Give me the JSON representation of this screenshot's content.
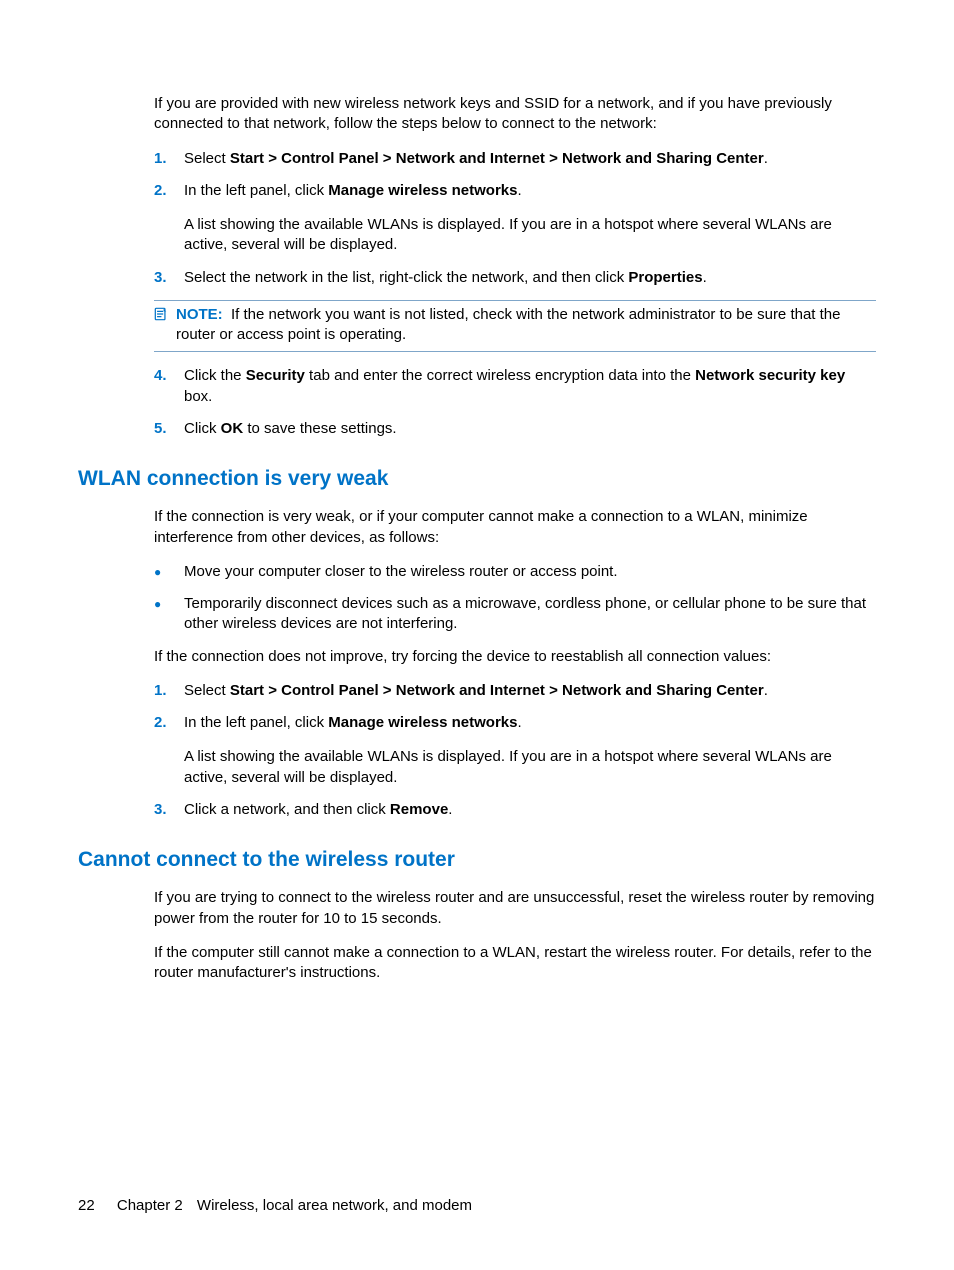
{
  "intro_para": "If you are provided with new wireless network keys and SSID for a network, and if you have previously connected to that network, follow the steps below to connect to the network:",
  "section1": {
    "steps": [
      {
        "num": "1.",
        "pre": "Select ",
        "bold": "Start > Control Panel > Network and Internet > Network and Sharing Center",
        "post": "."
      },
      {
        "num": "2.",
        "pre": "In the left panel, click ",
        "bold": "Manage wireless networks",
        "post": ".",
        "extra": "A list showing the available WLANs is displayed. If you are in a hotspot where several WLANs are active, several will be displayed."
      },
      {
        "num": "3.",
        "pre": "Select the network in the list, right-click the network, and then click ",
        "bold": "Properties",
        "post": "."
      }
    ],
    "note_label": "NOTE:",
    "note_text": "If the network you want is not listed, check with the network administrator to be sure that the router or access point is operating.",
    "steps_after": [
      {
        "num": "4.",
        "pre": "Click the ",
        "bold1": "Security",
        "mid": " tab and enter the correct wireless encryption data into the ",
        "bold2": "Network security key",
        "post": " box."
      },
      {
        "num": "5.",
        "pre": "Click ",
        "bold": "OK",
        "post": " to save these settings."
      }
    ]
  },
  "section2": {
    "heading": "WLAN connection is very weak",
    "intro": "If the connection is very weak, or if your computer cannot make a connection to a WLAN, minimize interference from other devices, as follows:",
    "bullets": [
      "Move your computer closer to the wireless router or access point.",
      "Temporarily disconnect devices such as a microwave, cordless phone, or cellular phone to be sure that other wireless devices are not interfering."
    ],
    "after_bullets": "If the connection does not improve, try forcing the device to reestablish all connection values:",
    "steps": [
      {
        "num": "1.",
        "pre": "Select ",
        "bold": "Start > Control Panel > Network and Internet > Network and Sharing Center",
        "post": "."
      },
      {
        "num": "2.",
        "pre": "In the left panel, click ",
        "bold": "Manage wireless networks",
        "post": ".",
        "extra": "A list showing the available WLANs is displayed. If you are in a hotspot where several WLANs are active, several will be displayed."
      },
      {
        "num": "3.",
        "pre": "Click a network, and then click ",
        "bold": "Remove",
        "post": "."
      }
    ]
  },
  "section3": {
    "heading": "Cannot connect to the wireless router",
    "p1": "If you are trying to connect to the wireless router and are unsuccessful, reset the wireless router by removing power from the router for 10 to 15 seconds.",
    "p2": "If the computer still cannot make a connection to a WLAN, restart the wireless router. For details, refer to the router manufacturer's instructions."
  },
  "footer": {
    "page": "22",
    "chapter": "Chapter 2",
    "title": "Wireless, local area network, and modem"
  }
}
